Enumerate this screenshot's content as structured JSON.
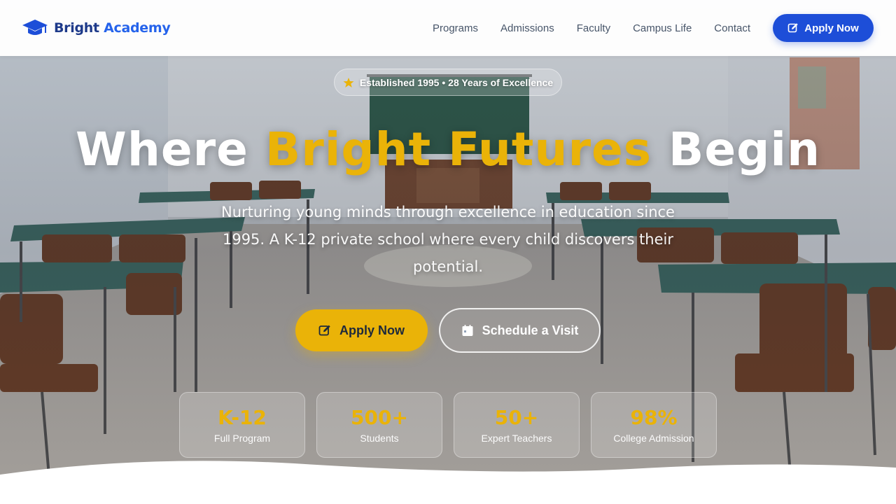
{
  "brand": {
    "name_part1": "Bright",
    "name_part2": "Academy",
    "icon": "graduation-cap-icon"
  },
  "nav": {
    "links": [
      "Programs",
      "Admissions",
      "Faculty",
      "Campus Life",
      "Contact"
    ],
    "cta_label": "Apply Now",
    "cta_icon": "edit-icon"
  },
  "hero": {
    "badge_text": "Established 1995 • 28 Years of Excellence",
    "badge_icon": "star-icon",
    "headline_start": "Where ",
    "headline_highlight": "Bright Futures",
    "headline_end": " Begin",
    "subtext": "Nurturing young minds through excellence in education since 1995. A K-12 private school where every child discovers their potential.",
    "primary_button": "Apply Now",
    "primary_icon": "edit-icon",
    "secondary_button": "Schedule a Visit",
    "secondary_icon": "calendar-icon"
  },
  "stats": [
    {
      "value": "K-12",
      "label": "Full Program"
    },
    {
      "value": "500+",
      "label": "Students"
    },
    {
      "value": "50+",
      "label": "Expert Teachers"
    },
    {
      "value": "98%",
      "label": "College Admission"
    }
  ],
  "colors": {
    "primary": "#1d4ed8",
    "accent": "#eab308",
    "brand_dark": "#1e3a8a",
    "nav_text": "#475569"
  }
}
